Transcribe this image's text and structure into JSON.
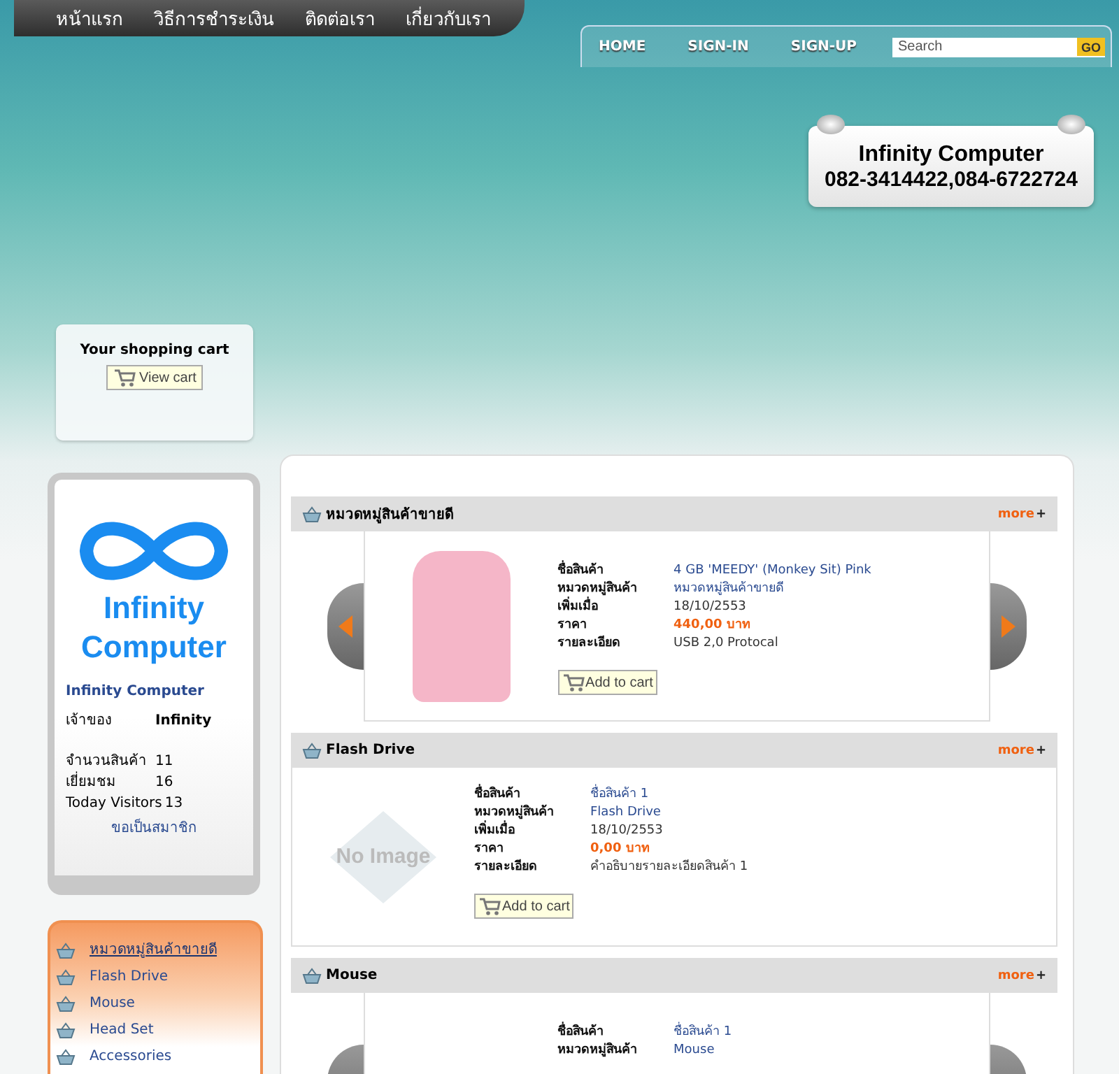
{
  "top_nav": [
    {
      "label": "หน้าแรก"
    },
    {
      "label": "วิธีการชำระเงิน"
    },
    {
      "label": "ติดต่อเรา"
    },
    {
      "label": "เกี่ยวกับเรา"
    }
  ],
  "user_nav": {
    "links": [
      {
        "label": "HOME"
      },
      {
        "label": "SIGN-IN"
      },
      {
        "label": "SIGN-UP"
      }
    ],
    "search": {
      "placeholder": "Search"
    },
    "go_button": "GO"
  },
  "contact_card": {
    "name": "Infinity Computer",
    "phones": "082-3414422,084-6722724"
  },
  "cart_box": {
    "title": "Your shopping cart",
    "button": "View cart"
  },
  "profile": {
    "logo_text": "Infinity Computer",
    "shop_name": "Infinity Computer",
    "owner": {
      "label": "เจ้าของ",
      "value": "Infinity"
    },
    "stats": [
      {
        "label": "จำนวนสินค้า",
        "value": "11"
      },
      {
        "label": "เยี่ยมชม",
        "value": "16"
      },
      {
        "label": "Today Visitors",
        "value": "13"
      }
    ],
    "signup_link": "ขอเป็นสมาชิก"
  },
  "category_menu": [
    {
      "label": "หมวดหมู่สินค้าขายดี",
      "selected": true
    },
    {
      "label": "Flash Drive",
      "selected": false
    },
    {
      "label": "Mouse",
      "selected": false
    },
    {
      "label": "Head Set",
      "selected": false
    },
    {
      "label": "Accessories",
      "selected": false
    }
  ],
  "sections": [
    {
      "title": "หมวดหมู่สินค้าขายดี",
      "more": "more",
      "more_sign": "+",
      "kind": "carousel",
      "button": "Add to cart",
      "details": [
        {
          "label": "ชื่อสินค้า",
          "value": "4 GB 'MEEDY' (Monkey Sit) Pink",
          "kind": "link"
        },
        {
          "label": "หมวดหมู่สินค้า",
          "value": "หมวดหมู่สินค้าขายดี",
          "kind": "link"
        },
        {
          "label": "เพิ่มเมื่อ",
          "value": "18/10/2553",
          "kind": "plain"
        },
        {
          "label": "ราคา",
          "value": "440,00 บาท",
          "kind": "price"
        },
        {
          "label": "รายละเอียด",
          "value": "USB 2,0 Protocal",
          "kind": "plain"
        }
      ]
    },
    {
      "title": "Flash Drive",
      "more": "more",
      "more_sign": "+",
      "kind": "list",
      "no_image_label": "No Image",
      "button": "Add to cart",
      "details": [
        {
          "label": "ชื่อสินค้า",
          "value": "ชื่อสินค้า 1",
          "kind": "link"
        },
        {
          "label": "หมวดหมู่สินค้า",
          "value": "Flash Drive",
          "kind": "link"
        },
        {
          "label": "เพิ่มเมื่อ",
          "value": "18/10/2553",
          "kind": "plain"
        },
        {
          "label": "ราคา",
          "value": "0,00 บาท",
          "kind": "price"
        },
        {
          "label": "รายละเอียด",
          "value": "คำอธิบายรายละเอียดสินค้า 1",
          "kind": "plain"
        }
      ]
    },
    {
      "title": "Mouse",
      "more": "more",
      "more_sign": "+",
      "kind": "carousel",
      "details": [
        {
          "label": "ชื่อสินค้า",
          "value": "ชื่อสินค้า 1",
          "kind": "link"
        },
        {
          "label": "หมวดหมู่สินค้า",
          "value": "Mouse",
          "kind": "link"
        }
      ]
    }
  ]
}
